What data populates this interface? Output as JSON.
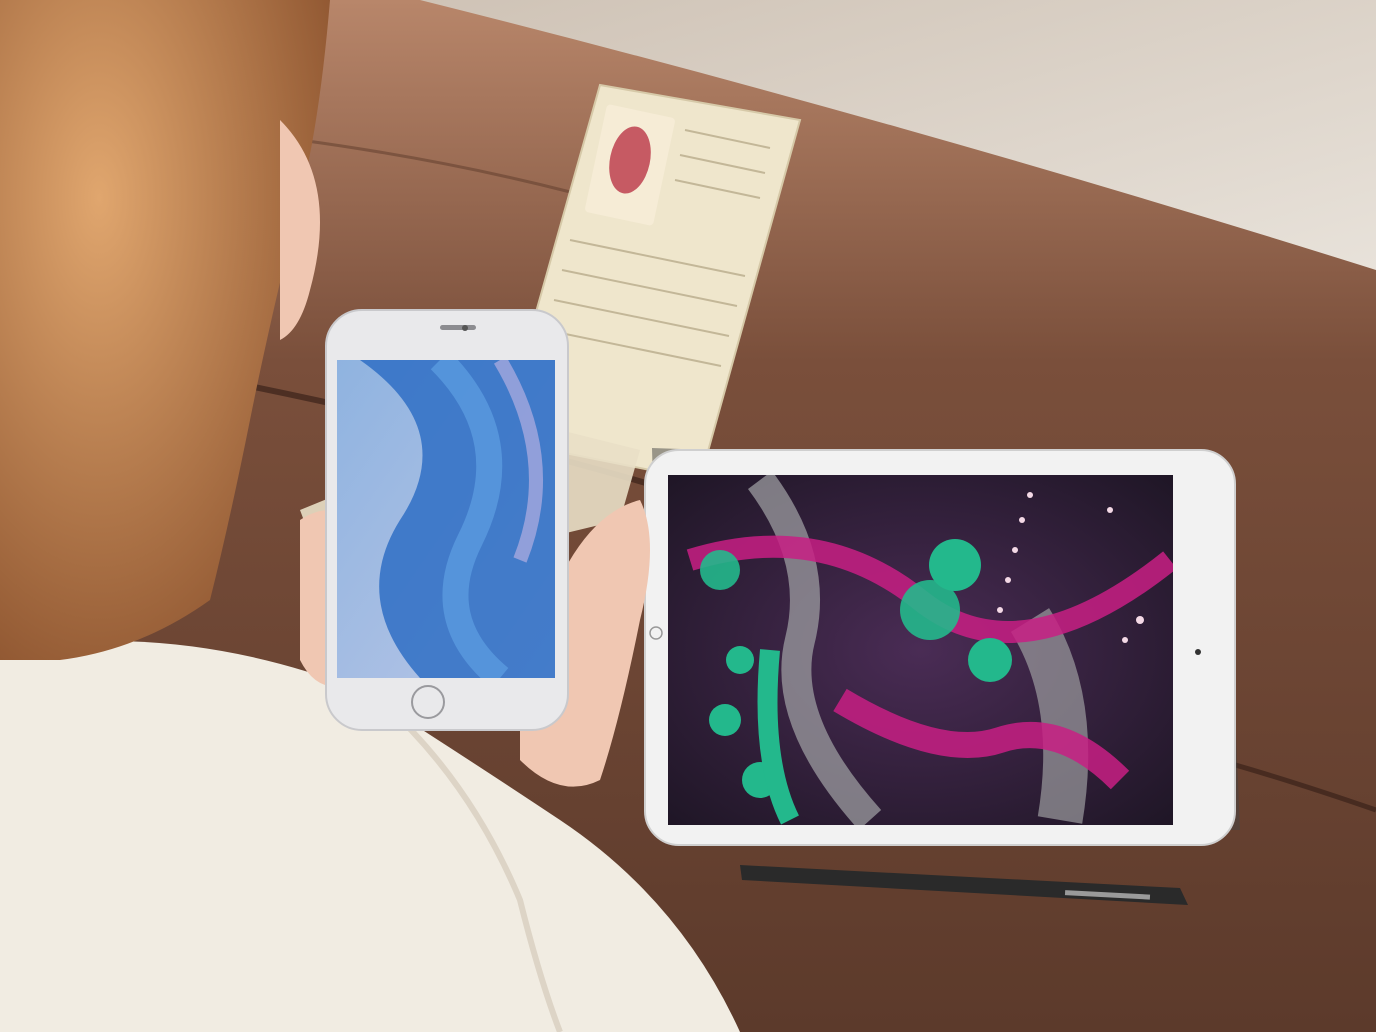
{
  "scene": {
    "wall_color": "#d8d0c6",
    "table_color": "#7a4f3b",
    "table_shadow": "#4e3024",
    "hair_color": "#b5753f",
    "shirt_color": "#f1ece2",
    "skin_color": "#f0c7b2"
  },
  "phone": {
    "body_color": "#e9e9eb",
    "screen_bg": "#9fb5dd",
    "wallpaper_accent": "#2f6fc4"
  },
  "tablet": {
    "body_color": "#f2f2f2",
    "screen_bg": "#2a1e33",
    "accent_magenta": "#c81e84",
    "accent_green": "#23b88c",
    "accent_grey": "#9c9ca0"
  },
  "book": {
    "page_color": "#efe6cc",
    "illustration_color": "#c65a63"
  },
  "pen": {
    "color": "#2a2a2a",
    "clip_color": "#9a9a9a"
  }
}
